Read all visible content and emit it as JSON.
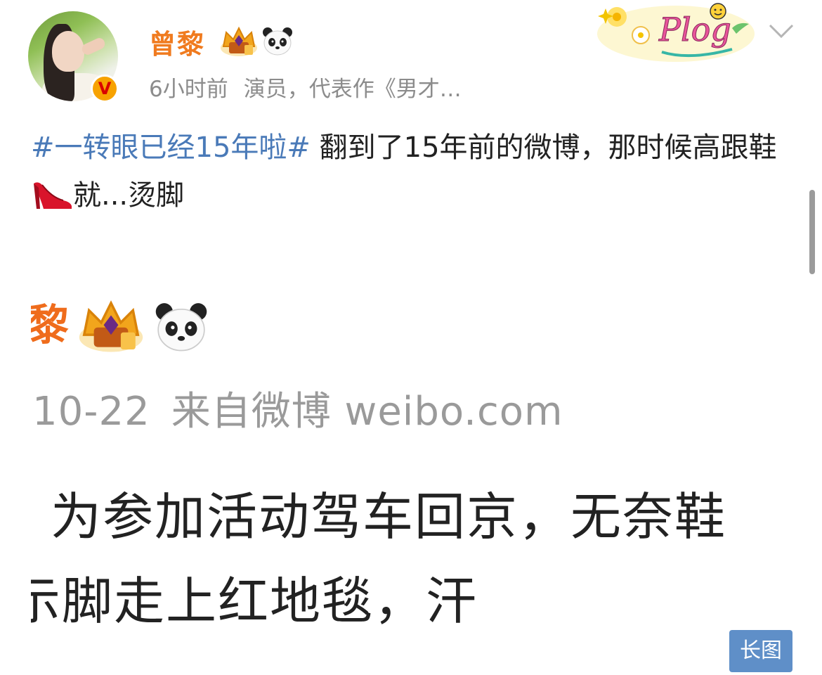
{
  "header": {
    "username": "曾黎",
    "time": "6小时前",
    "description": "演员，代表作《男才…",
    "sticker_text": "Plog"
  },
  "post": {
    "hashtag": "#一转眼已经15年啦#",
    "text_part1": " 翻到了15年前的微博，那时候高跟鞋",
    "text_part2": "就...烫脚"
  },
  "embedded_post": {
    "name_fragment": "黎",
    "date": "10-22",
    "source": "来自微博 weibo.com",
    "line1": "为参加活动驾车回京，无奈鞋",
    "line2": "示脚走上红地毯，汗"
  },
  "long_image_label": "长图",
  "icons": [
    "verified-v-icon",
    "crown-badge-icon",
    "panda-icon",
    "high-heel-icon",
    "chevron-down-icon"
  ],
  "colors": {
    "username": "#f07b1f",
    "hashtag": "#4a7ab8",
    "meta": "#8c8c8c",
    "long_image_bg": "#5f8fc8",
    "verified_badge": "#f7a200"
  }
}
